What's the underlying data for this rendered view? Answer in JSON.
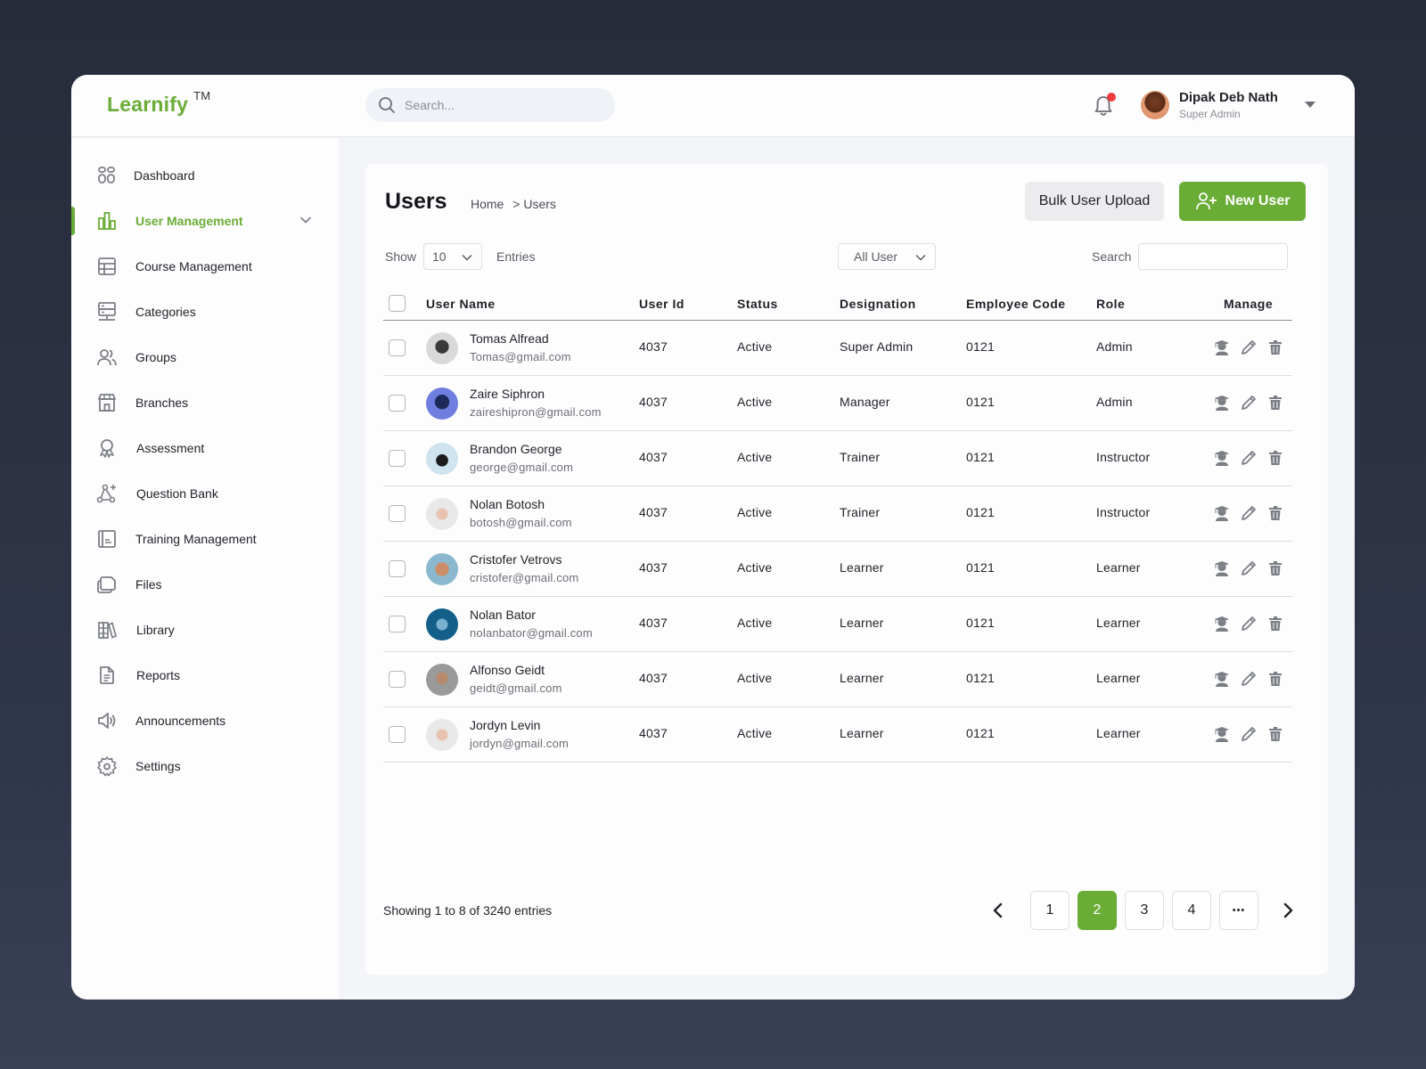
{
  "app": {
    "logo": "Learnify",
    "logo_tm": "TM"
  },
  "topbar": {
    "search_placeholder": "Search...",
    "notification_icon": "bell-icon",
    "has_notification": true,
    "profile": {
      "name": "Dipak Deb Nath",
      "role": "Super Admin"
    }
  },
  "sidebar": {
    "items": [
      {
        "label": "Dashboard",
        "icon": "dashboard-icon"
      },
      {
        "label": "User Management",
        "icon": "bar-chart-icon",
        "active": true,
        "expandable": true
      },
      {
        "label": "Course Management",
        "icon": "table-icon"
      },
      {
        "label": "Categories",
        "icon": "server-icon"
      },
      {
        "label": "Groups",
        "icon": "users-icon"
      },
      {
        "label": "Branches",
        "icon": "store-icon"
      },
      {
        "label": "Assessment",
        "icon": "award-icon"
      },
      {
        "label": "Question Bank",
        "icon": "network-icon"
      },
      {
        "label": "Training Management",
        "icon": "book-icon"
      },
      {
        "label": "Files",
        "icon": "files-icon"
      },
      {
        "label": "Library",
        "icon": "library-icon"
      },
      {
        "label": "Reports",
        "icon": "document-icon"
      },
      {
        "label": "Announcements",
        "icon": "speaker-icon"
      },
      {
        "label": "Settings",
        "icon": "gear-icon"
      }
    ]
  },
  "main": {
    "title": "Users",
    "breadcrumb": {
      "home": "Home",
      "separator": ">",
      "current": "Users"
    },
    "bulk_upload_label": "Bulk User Upload",
    "new_user_label": "New User",
    "show_label": "Show",
    "entries_select": "10",
    "entries_label": "Entries",
    "filter_select": "All User",
    "search_label": "Search",
    "search_value": ""
  },
  "table": {
    "columns": [
      "User Name",
      "User Id",
      "Status",
      "Designation",
      "Employee Code",
      "Role",
      "Manage"
    ],
    "rows": [
      {
        "name": "Tomas Alfread",
        "email": "Tomas@gmail.com",
        "user_id": "4037",
        "status": "Active",
        "designation": "Super Admin",
        "employee_code": "0121",
        "role": "Admin"
      },
      {
        "name": "Zaire Siphron",
        "email": "zaireshipron@gmail.com",
        "user_id": "4037",
        "status": "Active",
        "designation": "Manager",
        "employee_code": "0121",
        "role": "Admin"
      },
      {
        "name": "Brandon George",
        "email": "george@gmail.com",
        "user_id": "4037",
        "status": "Active",
        "designation": "Trainer",
        "employee_code": "0121",
        "role": "Instructor"
      },
      {
        "name": "Nolan Botosh",
        "email": "botosh@gmail.com",
        "user_id": "4037",
        "status": "Active",
        "designation": "Trainer",
        "employee_code": "0121",
        "role": "Instructor"
      },
      {
        "name": "Cristofer Vetrovs",
        "email": "cristofer@gmail.com",
        "user_id": "4037",
        "status": "Active",
        "designation": "Learner",
        "employee_code": "0121",
        "role": "Learner"
      },
      {
        "name": "Nolan Bator",
        "email": "nolanbator@gmail.com",
        "user_id": "4037",
        "status": "Active",
        "designation": "Learner",
        "employee_code": "0121",
        "role": "Learner"
      },
      {
        "name": "Alfonso Geidt",
        "email": "geidt@gmail.com",
        "user_id": "4037",
        "status": "Active",
        "designation": "Learner",
        "employee_code": "0121",
        "role": "Learner"
      },
      {
        "name": "Jordyn Levin",
        "email": "jordyn@gmail.com",
        "user_id": "4037",
        "status": "Active",
        "designation": "Learner",
        "employee_code": "0121",
        "role": "Learner"
      }
    ]
  },
  "footer": {
    "showing_text": "Showing 1 to 8 of 3240 entries",
    "pages": [
      "1",
      "2",
      "3",
      "4",
      "..."
    ],
    "current_page": "2"
  },
  "colors": {
    "accent": "#6aad36",
    "notification": "#ef3b3b",
    "background": "#2b3040"
  }
}
